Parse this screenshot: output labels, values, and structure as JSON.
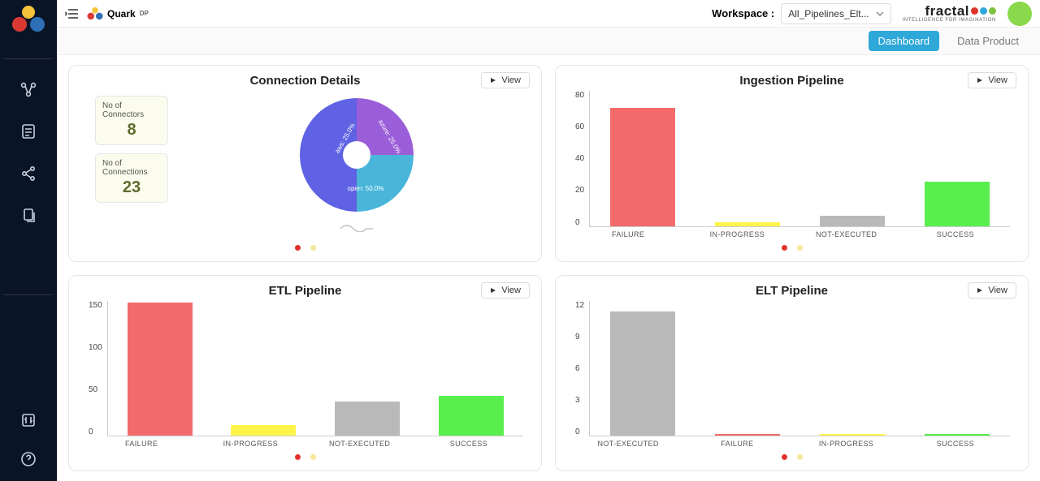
{
  "topbar": {
    "brand_name": "Quark",
    "brand_suffix": "DP",
    "workspace_label": "Workspace :",
    "workspace_value": "All_Pipelines_Elt...",
    "company_name": "fractal",
    "company_tagline": "INTELLIGENCE FOR IMAGINATION",
    "company_dot_colors": [
      "#e1332d",
      "#2ea7d9",
      "#7ec242"
    ]
  },
  "subbar": {
    "dashboard": "Dashboard",
    "data_product": "Data Product"
  },
  "cards": {
    "connection": {
      "title": "Connection Details",
      "view": "View",
      "stat1_label": "No of Connectors",
      "stat1_value": "8",
      "stat2_label": "No of Connections",
      "stat2_value": "23",
      "slice_aws": "aws: 25.0%",
      "slice_azure": "azure: 25.0%",
      "slice_open": "open: 50.0%"
    },
    "ingestion": {
      "title": "Ingestion Pipeline",
      "view": "View"
    },
    "etl": {
      "title": "ETL Pipeline",
      "view": "View"
    },
    "elt": {
      "title": "ELT Pipeline",
      "view": "View"
    }
  },
  "chart_data": [
    {
      "id": "connection_donut",
      "type": "pie",
      "title": "Connection Details",
      "series": [
        {
          "name": "aws",
          "value": 25.0,
          "color": "#9b5ed9"
        },
        {
          "name": "azure",
          "value": 25.0,
          "color": "#49b5d9"
        },
        {
          "name": "open",
          "value": 50.0,
          "color": "#5f63e3"
        }
      ]
    },
    {
      "id": "ingestion_bar",
      "type": "bar",
      "title": "Ingestion Pipeline",
      "categories": [
        "FAILURE",
        "IN-PROGRESS",
        "NOT-EXECUTED",
        "SUCCESS"
      ],
      "values": [
        70,
        2,
        6,
        26
      ],
      "colors": [
        "#f36b6b",
        "#fff44a",
        "#b9b9b9",
        "#59ef4d"
      ],
      "ylim": [
        0,
        80
      ],
      "yticks": [
        0,
        20,
        40,
        60,
        80
      ]
    },
    {
      "id": "etl_bar",
      "type": "bar",
      "title": "ETL Pipeline",
      "categories": [
        "FAILURE",
        "IN-PROGRESS",
        "NOT-EXECUTED",
        "SUCCESS"
      ],
      "values": [
        148,
        12,
        38,
        44
      ],
      "colors": [
        "#f36b6b",
        "#fff44a",
        "#b9b9b9",
        "#59ef4d"
      ],
      "ylim": [
        0,
        150
      ],
      "yticks": [
        0,
        50,
        100,
        150
      ]
    },
    {
      "id": "elt_bar",
      "type": "bar",
      "title": "ELT Pipeline",
      "categories": [
        "NOT-EXECUTED",
        "FAILURE",
        "IN-PROGRESS",
        "SUCCESS"
      ],
      "values": [
        11,
        0,
        0,
        0
      ],
      "colors": [
        "#b9b9b9",
        "#f36b6b",
        "#fff44a",
        "#59ef4d"
      ],
      "ylim": [
        0,
        12
      ],
      "yticks": [
        0,
        3,
        6,
        9,
        12
      ]
    }
  ]
}
